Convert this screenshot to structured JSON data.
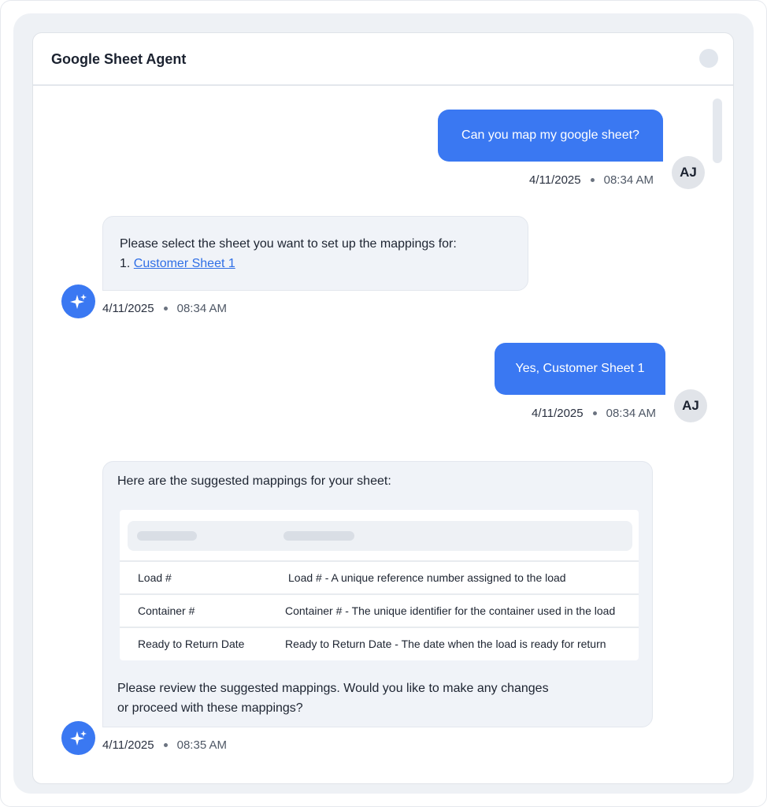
{
  "header": {
    "title": "Google Sheet Agent"
  },
  "messages": [
    {
      "sender": "user",
      "avatar": "AJ",
      "text": "Can you map my google sheet?",
      "date": "4/11/2025",
      "time": "08:34 AM"
    },
    {
      "sender": "agent",
      "text_prefix": "Please select the sheet you want to set up the mappings for:",
      "list_number": "1.",
      "link_text": "Customer Sheet 1",
      "date": "4/11/2025",
      "time": "08:34 AM"
    },
    {
      "sender": "user",
      "avatar": "AJ",
      "text": "Yes, Customer Sheet 1",
      "date": "4/11/2025",
      "time": "08:34 AM"
    },
    {
      "sender": "agent",
      "intro": "Here are the suggested mappings for your sheet:",
      "table": {
        "rows": [
          {
            "field": "Load #",
            "description": "Load # - A unique reference number assigned to the load"
          },
          {
            "field": "Container #",
            "description": "Container # - The unique identifier for the container used in the load"
          },
          {
            "field": "Ready to Return Date",
            "description": "Ready to Return Date - The date when the load is ready for return"
          }
        ]
      },
      "outro_line1": "Please review the suggested mappings. Would you like to make any changes",
      "outro_line2": "or proceed with these mappings?",
      "date": "4/11/2025",
      "time": "08:35 AM"
    }
  ],
  "colors": {
    "user_bubble": "#3a78f2",
    "agent_bubble": "#f0f3f8",
    "link": "#2f6fe6"
  },
  "icons": {
    "agent_avatar": "sparkle-icon"
  }
}
